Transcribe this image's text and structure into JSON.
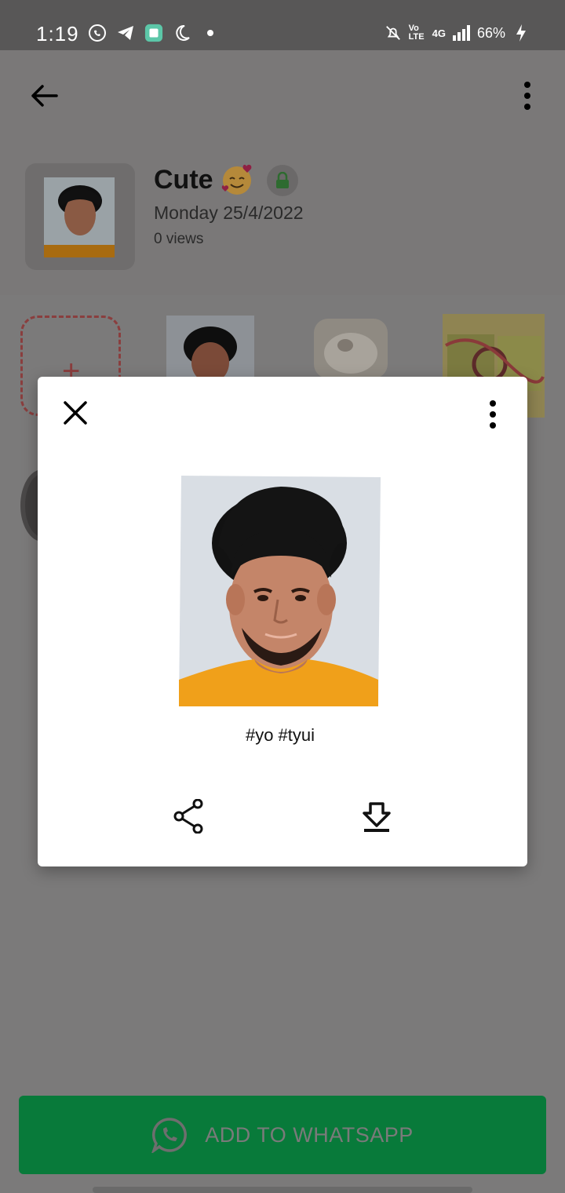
{
  "status_bar": {
    "time": "1:19",
    "battery": "66%",
    "network": "4G",
    "volte": "Vo LTE",
    "icons": [
      "whatsapp-icon",
      "telegram-icon",
      "app-icon",
      "moon-icon",
      "dot-icon"
    ]
  },
  "pack": {
    "title": "Cute",
    "emoji": "smiling-face-with-hearts",
    "date": "Monday 25/4/2022",
    "views": "0 views"
  },
  "dialog": {
    "tags": "#yo #tyui"
  },
  "add_button": {
    "label": "ADD TO WHATSAPP"
  },
  "colors": {
    "brand_green": "#087a3a",
    "lock_green": "#2e7d32",
    "overlay_gray": "#7a7878"
  }
}
